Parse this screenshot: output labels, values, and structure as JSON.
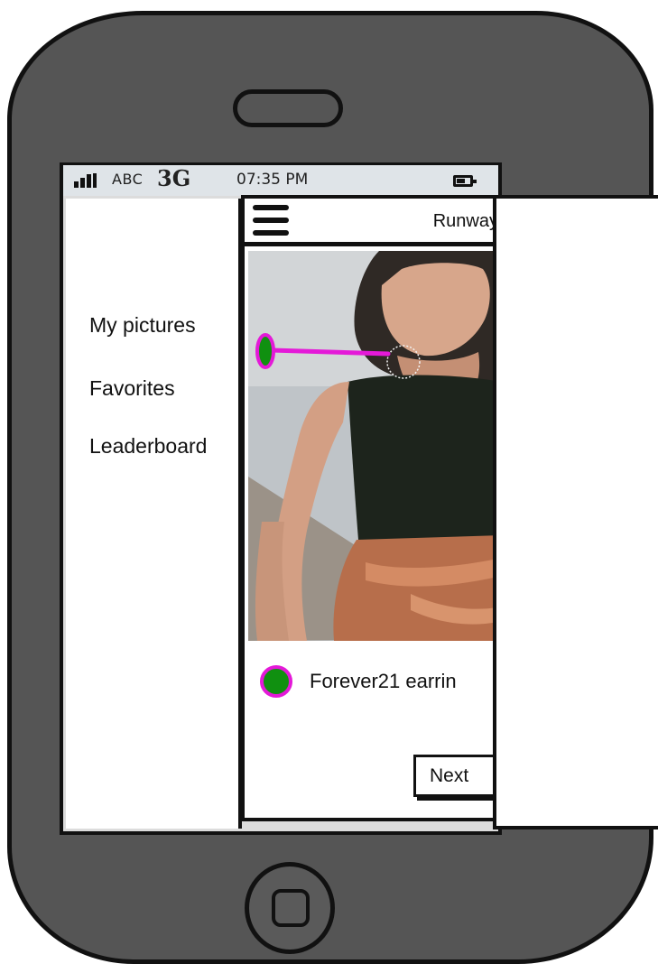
{
  "status_bar": {
    "carrier": "ABC",
    "network": "3G",
    "time": "07:35 PM",
    "signal_icon": "signal-bars-icon",
    "battery_icon": "battery-icon"
  },
  "side_menu": {
    "items": [
      {
        "label": "My pictures"
      },
      {
        "label": "Favorites"
      },
      {
        "label": "Leaderboard"
      }
    ]
  },
  "topbar": {
    "title": "Runway",
    "menu_icon": "hamburger-menu-icon"
  },
  "tag": {
    "label": "Forever21 earrin",
    "dot_color": "#109010",
    "outline_color": "#e419d8"
  },
  "buttons": {
    "next_label": "Next"
  },
  "colors": {
    "phone_body": "#555555",
    "status_bar": "#dfe4e8",
    "tag_line": "#e419d8",
    "tag_fill": "#109010"
  }
}
